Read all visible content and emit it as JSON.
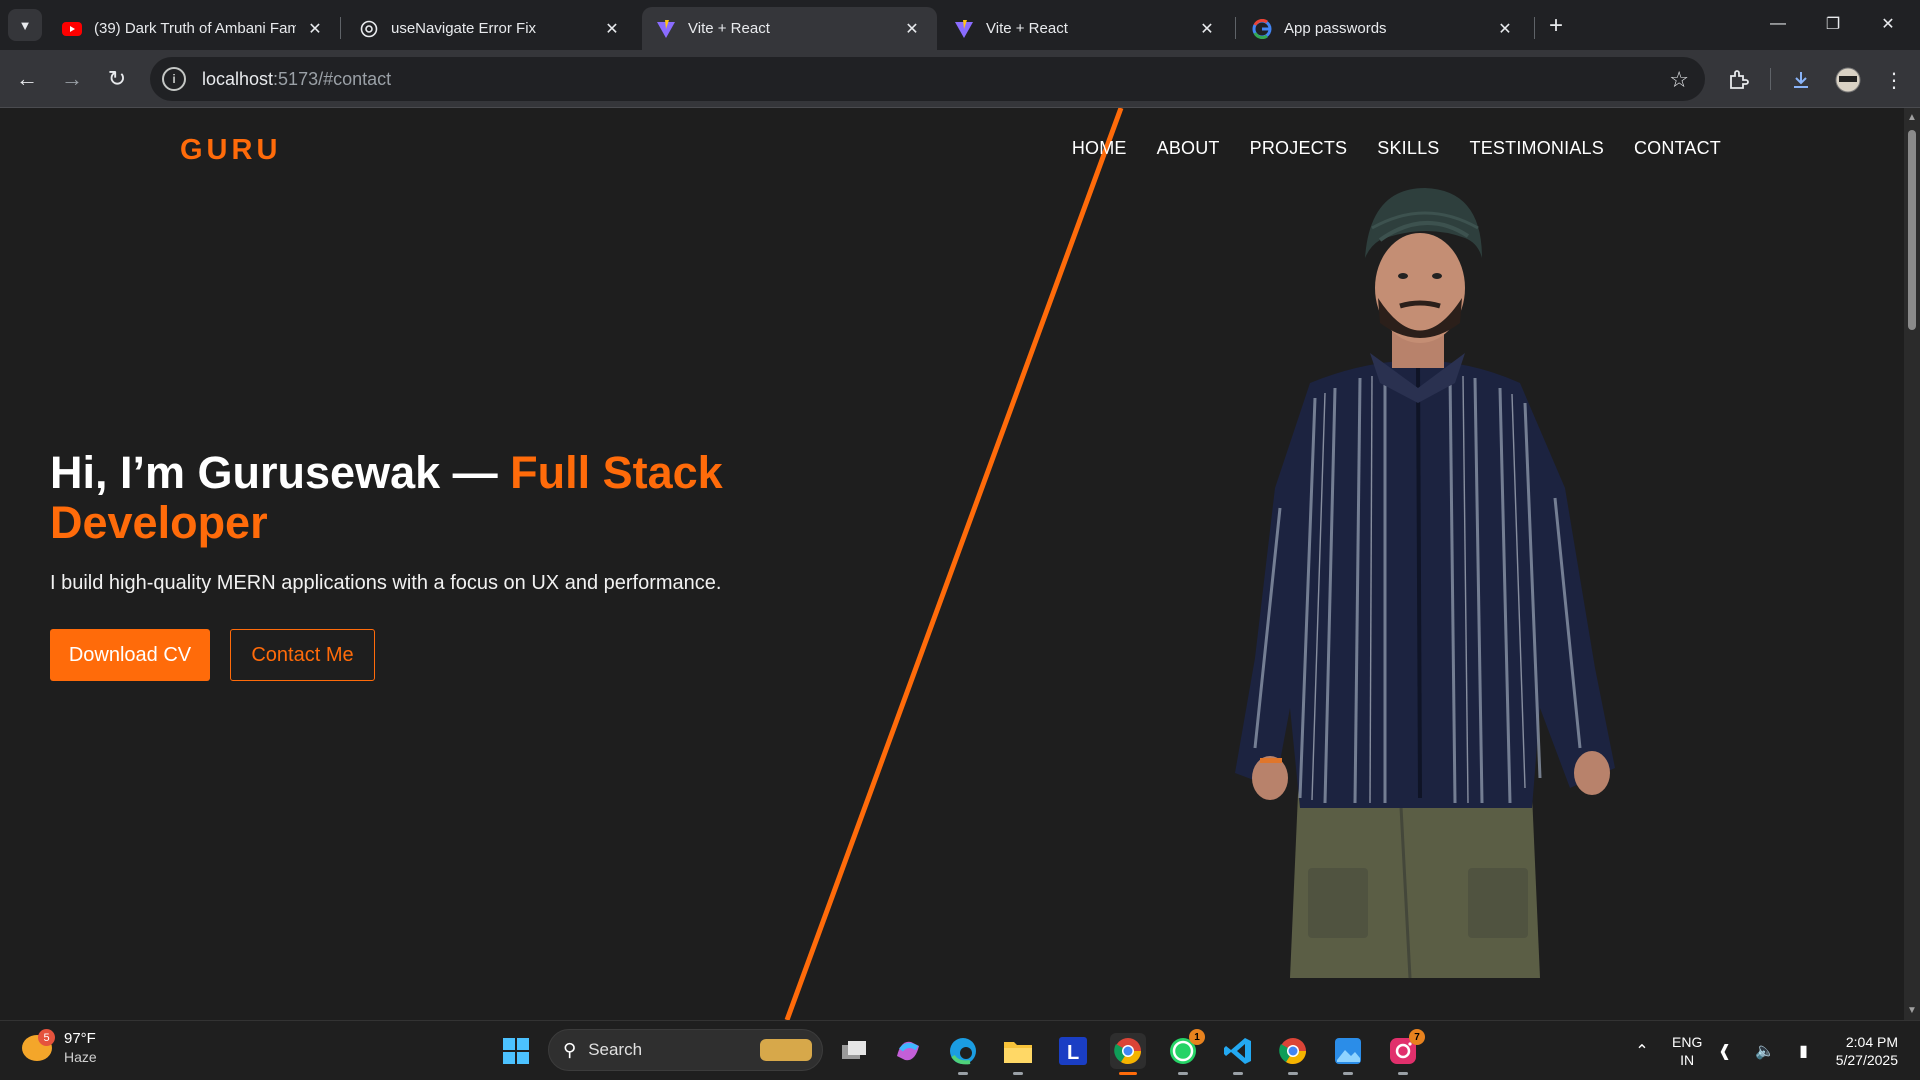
{
  "browser": {
    "tabs": [
      {
        "title": "(39) Dark Truth of Ambani Famil",
        "icon": "youtube-icon",
        "active": false
      },
      {
        "title": "useNavigate Error Fix",
        "icon": "chatgpt-icon",
        "active": false
      },
      {
        "title": "Vite + React",
        "icon": "vite-icon",
        "active": true
      },
      {
        "title": "Vite + React",
        "icon": "vite-icon",
        "active": false
      },
      {
        "title": "App passwords",
        "icon": "google-icon",
        "active": false
      }
    ],
    "url_host": "localhost",
    "url_rest": ":5173/#contact"
  },
  "page": {
    "logo": "GURU",
    "nav": [
      "HOME",
      "ABOUT",
      "PROJECTS",
      "SKILLS",
      "TESTIMONIALS",
      "CONTACT"
    ],
    "hero": {
      "title_main": "Hi, I’m Gurusewak — ",
      "title_accent": "Full Stack Developer",
      "subtitle": "I build high-quality MERN applications with a focus on UX and performance.",
      "primary_button": "Download CV",
      "secondary_button": "Contact Me"
    },
    "colors": {
      "accent": "#ff6b0a",
      "background": "#1e1e1e"
    }
  },
  "taskbar": {
    "weather_temp": "97°F",
    "weather_condition": "Haze",
    "weather_badge": "5",
    "search_label": "Search",
    "whatsapp_badge": "1",
    "instagram_badge": "7",
    "lang_top": "ENG",
    "lang_bottom": "IN",
    "time": "2:04 PM",
    "date": "5/27/2025"
  }
}
